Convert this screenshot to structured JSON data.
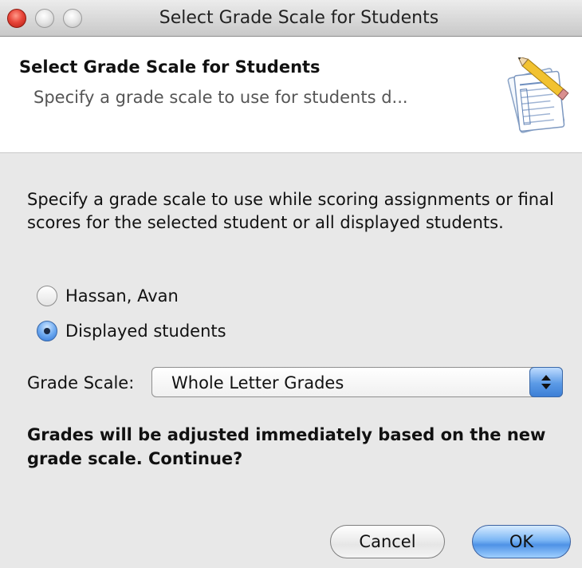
{
  "window": {
    "title": "Select Grade Scale for Students"
  },
  "header": {
    "title": "Select Grade Scale for Students",
    "subtitle": "Specify a grade scale to use for students d...",
    "icon": "gradebook-icon"
  },
  "body": {
    "description": "Specify a grade scale to use while scoring assignments or final scores for the selected student or all displayed students.",
    "options": [
      {
        "label": "Hassan, Avan",
        "selected": false
      },
      {
        "label": "Displayed students",
        "selected": true
      }
    ],
    "grade_scale_label": "Grade Scale:",
    "grade_scale_value": "Whole Letter Grades",
    "warning": "Grades will be adjusted immediately based on the new grade scale. Continue?"
  },
  "buttons": {
    "cancel": "Cancel",
    "ok": "OK"
  },
  "colors": {
    "accent": "#5b9ae6",
    "close_button": "#e8463a"
  }
}
